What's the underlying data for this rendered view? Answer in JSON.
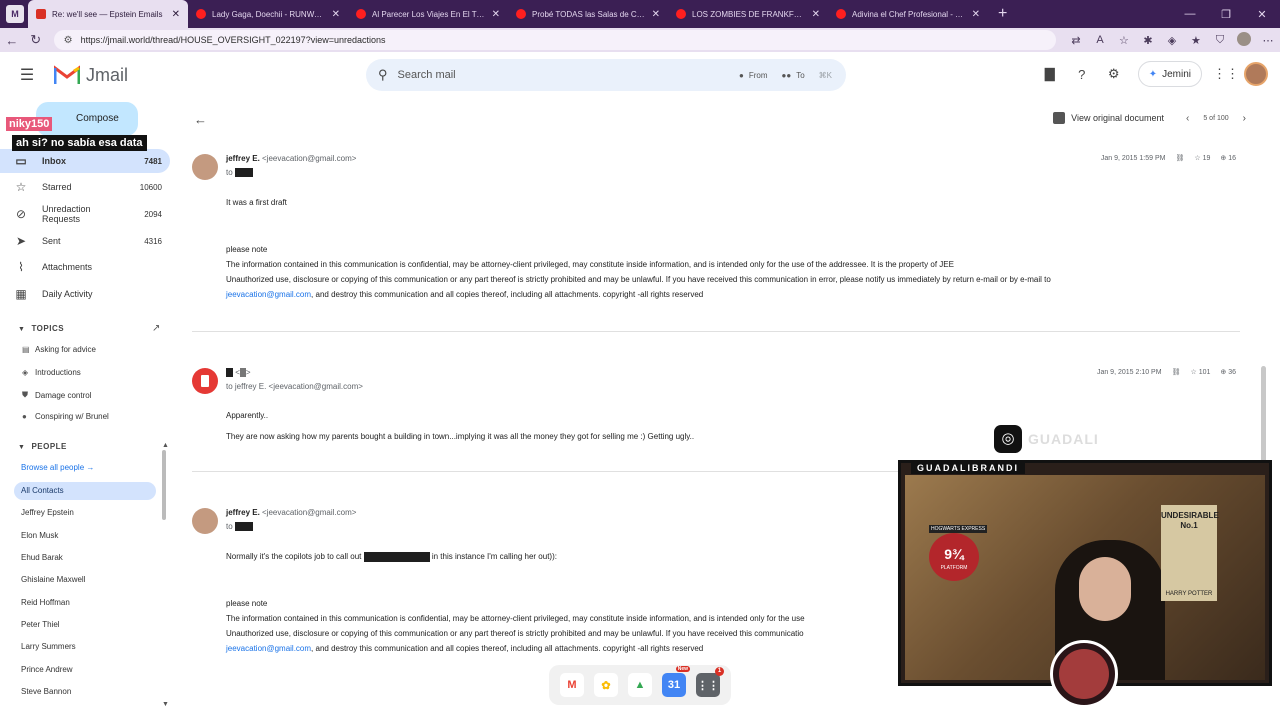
{
  "browser": {
    "tabs": [
      {
        "title": "Re: we'll see — Epstein Emails",
        "active": true,
        "favicon": "gmail-favicon"
      },
      {
        "title": "Lady Gaga, Doechii - RUNWAY (Of",
        "active": false,
        "favicon": "youtube-favicon"
      },
      {
        "title": "Al Parecer Los Viajes En El Tiempo",
        "active": false,
        "favicon": "youtube-favicon"
      },
      {
        "title": "Probé TODAS las Salas de Cine en",
        "active": false,
        "favicon": "youtube-favicon"
      },
      {
        "title": "LOS ZOMBIES DE FRANKFURT (JA",
        "active": false,
        "favicon": "youtube-favicon"
      },
      {
        "title": "Adivina el Chef Profesional - YouT",
        "active": false,
        "favicon": "youtube-favicon"
      }
    ],
    "url": "https://jmail.world/thread/HOUSE_OVERSIGHT_022197?view=unredactions"
  },
  "app": {
    "brand": "Jmail",
    "search_placeholder": "Search mail",
    "filter_from": "From",
    "filter_to": "To",
    "shortcut": "⌘K",
    "jemini_label": "Jemini"
  },
  "sidebar": {
    "compose_label": "Compose",
    "items": [
      {
        "label": "Inbox",
        "count": "7481",
        "icon": "inbox-icon"
      },
      {
        "label": "Starred",
        "count": "10600",
        "icon": "star-icon"
      },
      {
        "label": "Unredaction Requests",
        "count": "2094",
        "icon": "unredact-icon"
      },
      {
        "label": "Sent",
        "count": "4316",
        "icon": "send-icon"
      },
      {
        "label": "Attachments",
        "count": "",
        "icon": "paperclip-icon"
      },
      {
        "label": "Daily Activity",
        "count": "",
        "icon": "calendar-icon"
      }
    ],
    "topics_header": "TOPICS",
    "topics": [
      {
        "label": "Asking for advice"
      },
      {
        "label": "Introductions"
      },
      {
        "label": "Damage control"
      },
      {
        "label": "Conspiring w/ Brunel"
      }
    ],
    "people_header": "PEOPLE",
    "browse_all": "Browse all people →",
    "all_contacts": "All Contacts",
    "people": [
      "Jeffrey Epstein",
      "Elon Musk",
      "Ehud Barak",
      "Ghislaine Maxwell",
      "Reid Hoffman",
      "Peter Thiel",
      "Larry Summers",
      "Prince Andrew",
      "Steve Bannon"
    ]
  },
  "overlay_chat": {
    "username": "niky150",
    "message": "ah si? no sabía esa data"
  },
  "thread": {
    "view_original": "View original document",
    "pagination": "5 of 100",
    "messages": [
      {
        "sender": "jeffrey E.",
        "email": "<jeevacation@gmail.com>",
        "to_prefix": "to",
        "date": "Jan 9, 2015 1:59 PM",
        "stars": "19",
        "views": "16",
        "line1": "It was a first draft",
        "note": "please note",
        "disclaimer1": "The information contained in this communication is confidential, may be attorney-client privileged, may constitute inside information, and is intended only for the use of the addressee. It is the property of JEE",
        "disclaimer2": "Unauthorized use, disclosure or copying of this communication or any part thereof is strictly prohibited and may be unlawful. If you have received this communication in error, please notify us immediately by return e-mail or by e-mail to",
        "link": "jeevacation@gmail.com",
        "disclaimer3": ", and destroy this communication and all copies thereof, including all attachments. copyright -all rights reserved"
      },
      {
        "sender": "<",
        "to_line": "to jeffrey E. <jeevacation@gmail.com>",
        "date": "Jan 9, 2015 2:10 PM",
        "stars": "101",
        "views": "36",
        "line1": "Apparently..",
        "line2": "They are now asking how my parents bought a building in town...implying it was all the money they got for selling me :) Getting ugly.."
      },
      {
        "sender": "jeffrey E.",
        "email": "<jeevacation@gmail.com>",
        "to_prefix": "to",
        "line1_a": "Normally it's the copilots job to call out",
        "line1_b": "in this instance I'm calling her out)):",
        "note": "please note",
        "disclaimer1": "The information contained in this communication is confidential, may be attorney-client privileged, may constitute inside information, and is intended only for the use",
        "disclaimer2": "Unauthorized use, disclosure or copying of this communication or any part thereof is strictly prohibited and may be unlawful. If you have received this communicatio",
        "link": "jeevacation@gmail.com",
        "disclaimer3": ", and destroy this communication and all copies thereof, including all attachments. copyright -all rights reserved"
      }
    ]
  },
  "dock": {
    "badge_new": "New",
    "badge_count": "1"
  },
  "stream": {
    "instagram_handle": "GUADALI",
    "cam_label": "GUADALIBRANDI",
    "poster_title": "UNDESIRABLE No.1",
    "poster_name": "HARRY POTTER",
    "sign_text": "PLATFORM",
    "sign_number": "9¾",
    "hogwarts": "HOGWARTS EXPRESS"
  },
  "colors": {
    "accent": "#1a73e8",
    "tabstrip": "#3b1f54",
    "inbox_highlight": "#d3e3fd",
    "compose": "#c2e7ff"
  }
}
